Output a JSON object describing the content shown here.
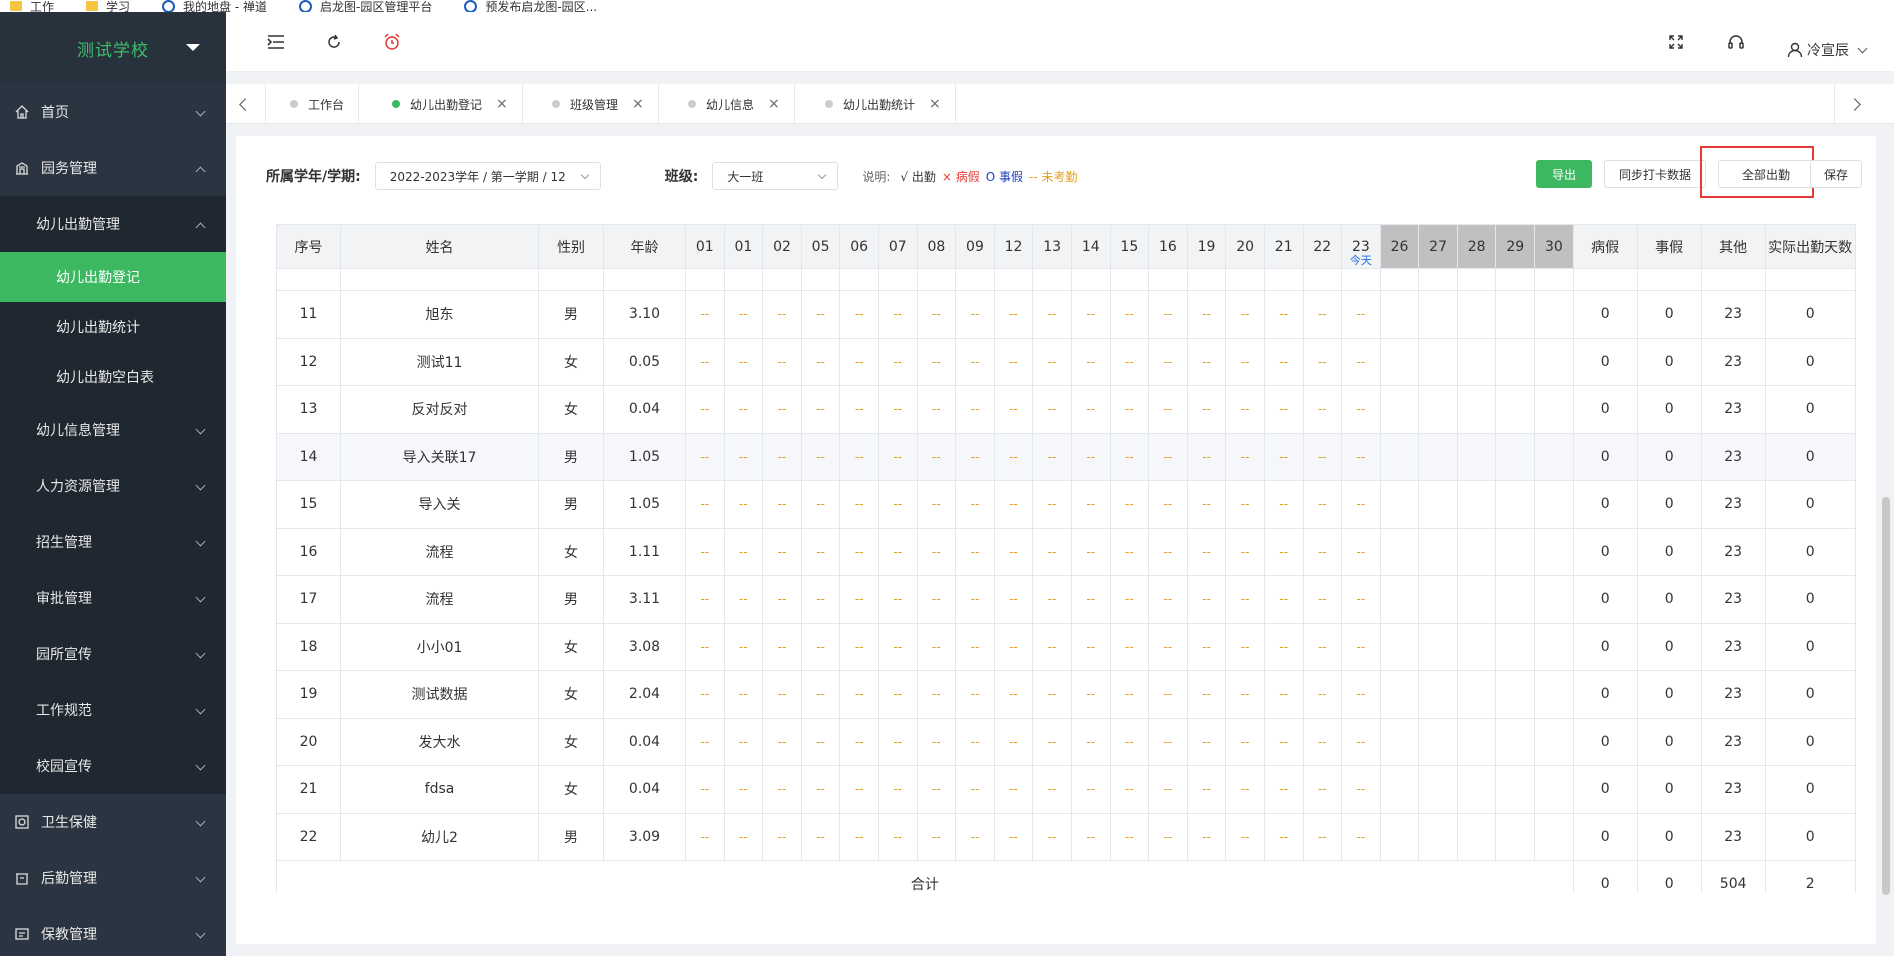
{
  "bookmarks": [
    {
      "label": "工作",
      "icon": "folder-icon"
    },
    {
      "label": "学习",
      "icon": "folder-icon"
    },
    {
      "label": "我的地盘 - 禅道",
      "icon": "globe-icon"
    },
    {
      "label": "启龙图-园区管理平台",
      "icon": "globe-icon"
    },
    {
      "label": "预发布启龙图-园区...",
      "icon": "globe-icon"
    }
  ],
  "sidebar": {
    "school": "测试学校",
    "items": [
      {
        "label": "首页"
      },
      {
        "label": "园务管理"
      },
      {
        "label": "幼儿出勤管理"
      },
      {
        "label": "幼儿出勤登记"
      },
      {
        "label": "幼儿出勤统计"
      },
      {
        "label": "幼儿出勤空白表"
      },
      {
        "label": "幼儿信息管理"
      },
      {
        "label": "人力资源管理"
      },
      {
        "label": "招生管理"
      },
      {
        "label": "审批管理"
      },
      {
        "label": "园所宣传"
      },
      {
        "label": "工作规范"
      },
      {
        "label": "校园宣传"
      },
      {
        "label": "卫生保健"
      },
      {
        "label": "后勤管理"
      },
      {
        "label": "保教管理"
      }
    ]
  },
  "header": {
    "user": "冷宣辰"
  },
  "tabs": [
    {
      "label": "工作台",
      "closable": false,
      "active": false
    },
    {
      "label": "幼儿出勤登记",
      "closable": true,
      "active": true
    },
    {
      "label": "班级管理",
      "closable": true,
      "active": false
    },
    {
      "label": "幼儿信息",
      "closable": true,
      "active": false
    },
    {
      "label": "幼儿出勤统计",
      "closable": true,
      "active": false
    }
  ],
  "filter": {
    "term_label": "所属学年/学期:",
    "term_value": "2022-2023学年 / 第一学期 / 12",
    "class_label": "班级:",
    "class_value": "大一班",
    "legend_prefix": "说明:",
    "legend_ok": "√ 出勤",
    "legend_sick": "× 病假",
    "legend_leave": "O 事假",
    "legend_na": "-- 未考勤"
  },
  "buttons": {
    "export": "导出",
    "sync": "同步打卡数据",
    "all_present": "全部出勤",
    "save": "保存"
  },
  "table": {
    "headers": {
      "index": "序号",
      "name": "姓名",
      "gender": "性别",
      "age": "年龄",
      "sick": "病假",
      "leave": "事假",
      "other": "其他",
      "actual": "实际出勤天数"
    },
    "days": [
      "01",
      "01",
      "02",
      "05",
      "06",
      "07",
      "08",
      "09",
      "12",
      "13",
      "14",
      "15",
      "16",
      "19",
      "20",
      "21",
      "22",
      "23",
      "26",
      "27",
      "28",
      "29",
      "30"
    ],
    "today_label": "今天",
    "not_recorded": "--",
    "rows": [
      {
        "index": "11",
        "name": "旭东",
        "gender": "男",
        "age": "3.10",
        "sick": "0",
        "leave": "0",
        "other": "23",
        "actual": "0"
      },
      {
        "index": "12",
        "name": "测试11",
        "gender": "女",
        "age": "0.05",
        "sick": "0",
        "leave": "0",
        "other": "23",
        "actual": "0"
      },
      {
        "index": "13",
        "name": "反对反对",
        "gender": "女",
        "age": "0.04",
        "sick": "0",
        "leave": "0",
        "other": "23",
        "actual": "0"
      },
      {
        "index": "14",
        "name": "导入关联17",
        "gender": "男",
        "age": "1.05",
        "sick": "0",
        "leave": "0",
        "other": "23",
        "actual": "0"
      },
      {
        "index": "15",
        "name": "导入关",
        "gender": "男",
        "age": "1.05",
        "sick": "0",
        "leave": "0",
        "other": "23",
        "actual": "0"
      },
      {
        "index": "16",
        "name": "流程",
        "gender": "女",
        "age": "1.11",
        "sick": "0",
        "leave": "0",
        "other": "23",
        "actual": "0"
      },
      {
        "index": "17",
        "name": "流程",
        "gender": "男",
        "age": "3.11",
        "sick": "0",
        "leave": "0",
        "other": "23",
        "actual": "0"
      },
      {
        "index": "18",
        "name": "小小01",
        "gender": "女",
        "age": "3.08",
        "sick": "0",
        "leave": "0",
        "other": "23",
        "actual": "0"
      },
      {
        "index": "19",
        "name": "测试数据",
        "gender": "女",
        "age": "2.04",
        "sick": "0",
        "leave": "0",
        "other": "23",
        "actual": "0"
      },
      {
        "index": "20",
        "name": "发大水",
        "gender": "女",
        "age": "0.04",
        "sick": "0",
        "leave": "0",
        "other": "23",
        "actual": "0"
      },
      {
        "index": "21",
        "name": "fdsa",
        "gender": "女",
        "age": "0.04",
        "sick": "0",
        "leave": "0",
        "other": "23",
        "actual": "0"
      },
      {
        "index": "22",
        "name": "幼儿2",
        "gender": "男",
        "age": "3.09",
        "sick": "0",
        "leave": "0",
        "other": "23",
        "actual": "0"
      }
    ],
    "total": {
      "label": "合计",
      "sick": "0",
      "leave": "0",
      "other": "504",
      "actual": "2"
    }
  }
}
